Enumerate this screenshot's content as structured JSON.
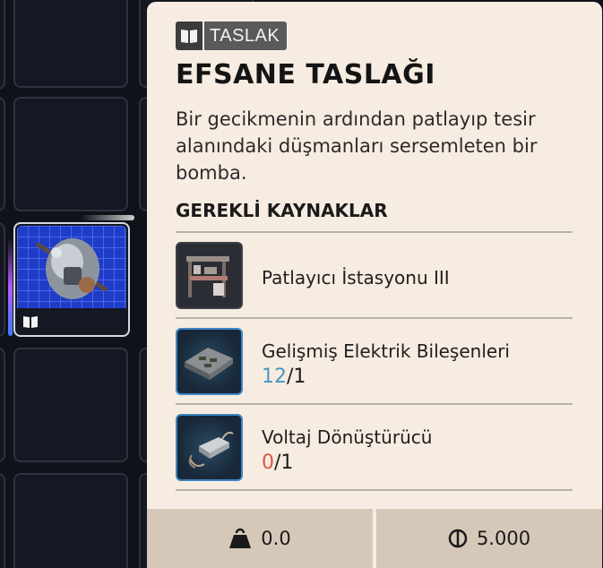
{
  "colors": {
    "background": "#10121a",
    "card": "#f7ece1",
    "footer": "#d6c8b8",
    "have_ok": "#4a97c2",
    "have_missing": "#e0553e",
    "selected_item_bg": "#1e3cc8"
  },
  "inventory": {
    "selected_item_icon": "blueprint-book-icon"
  },
  "tooltip": {
    "badge": {
      "icon": "blueprint-book-icon",
      "label": "TASLAK"
    },
    "title": "EFSANE TASLAĞI",
    "description": "Bir gecikmenin ardından patlayıp tesir alanındaki düşmanları sersemleten bir bomba.",
    "requirements_heading": "GEREKLİ KAYNAKLAR",
    "requirements": [
      {
        "name": "Patlayıcı İstasyonu III",
        "have": "",
        "sep": "",
        "need": ""
      },
      {
        "name": "Gelişmiş Elektrik Bileşenleri",
        "have": "12",
        "sep": "/",
        "need": "1"
      },
      {
        "name": "Voltaj Dönüştürücü",
        "have": "0",
        "sep": "/",
        "need": "1"
      }
    ],
    "footer": {
      "weight": "0.0",
      "weight_icon": "weight-icon",
      "price": "5.000",
      "price_icon": "coin-icon"
    }
  }
}
